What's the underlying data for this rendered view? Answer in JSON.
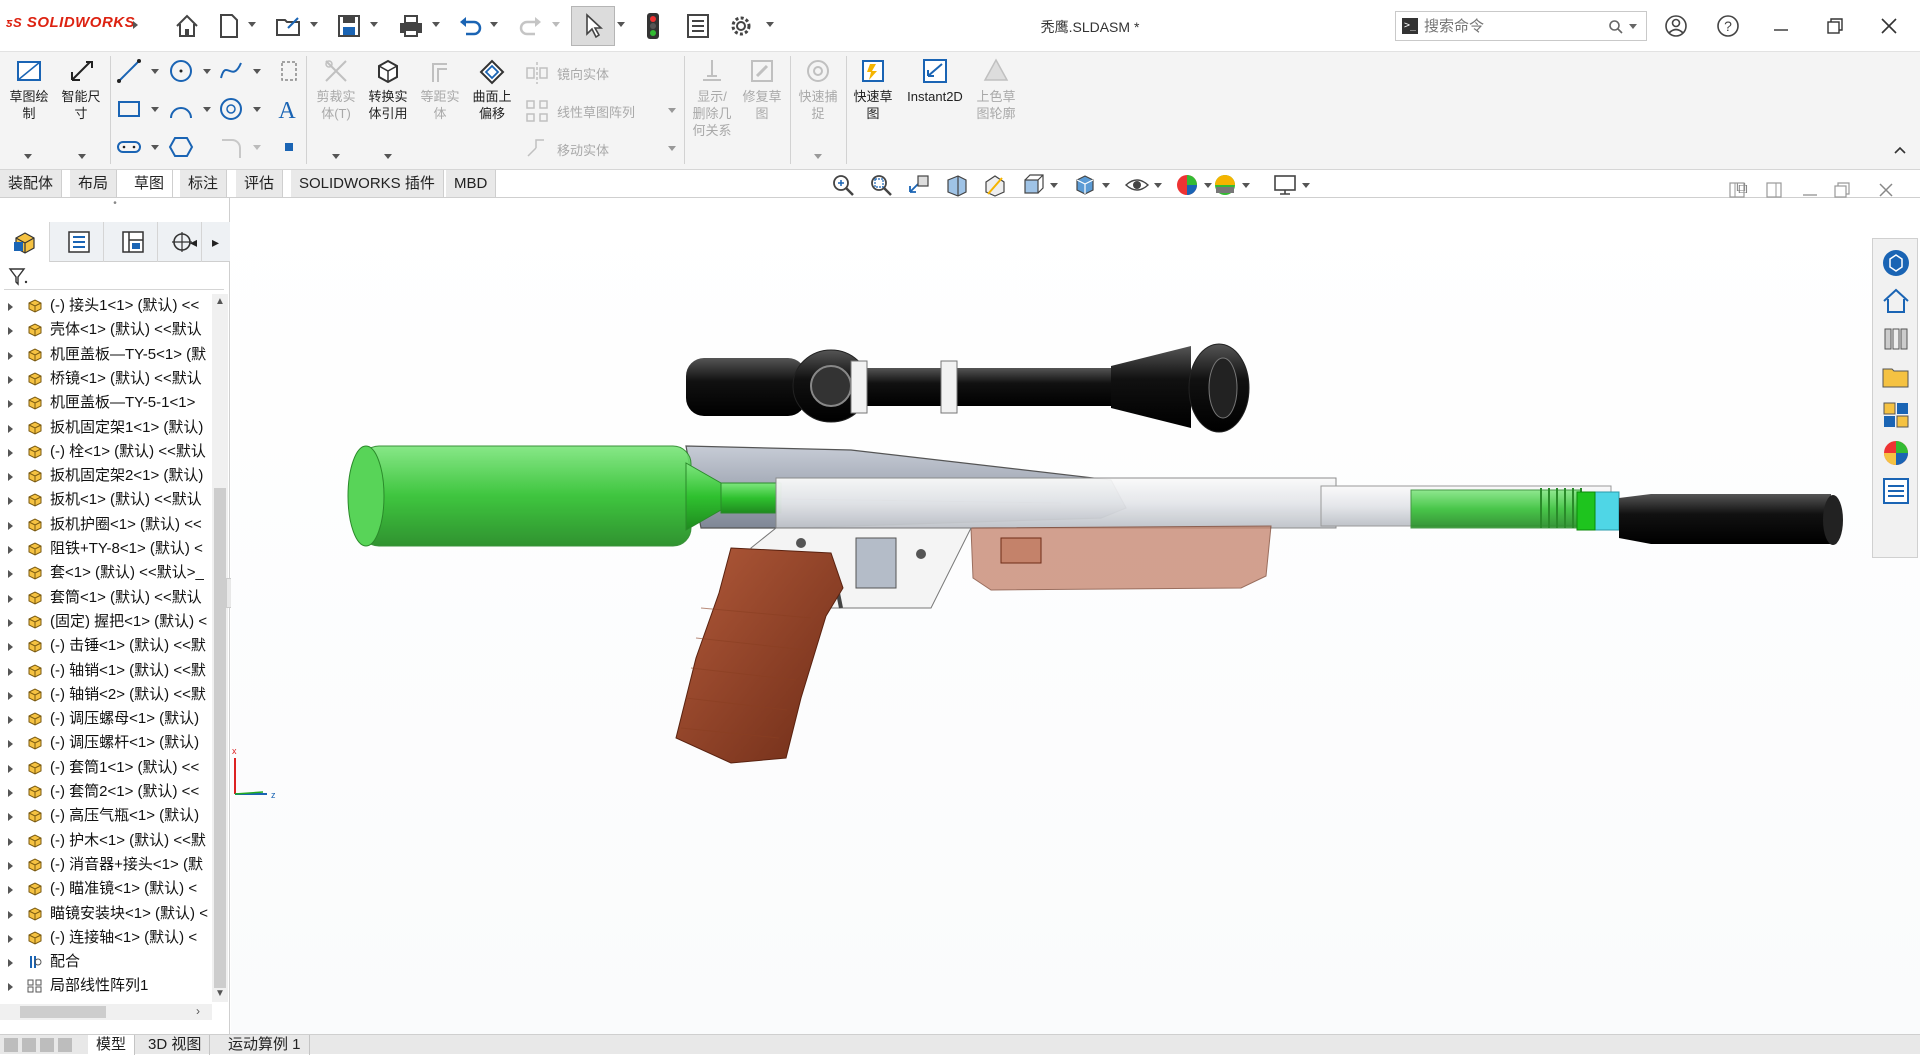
{
  "app": {
    "brand": "SOLIDWORKS",
    "document_title": "秃鹰.SLDASM *"
  },
  "search": {
    "placeholder": "搜索命令"
  },
  "ribbon": {
    "sketch_label": "草图绘\n制",
    "smart_dim_label": "智能尺\n寸",
    "trim_label": "剪裁实\n体(T)",
    "convert_label": "转换实\n体引用",
    "offset_label": "等距实\n体",
    "surface_offset_label": "曲面上\n偏移",
    "mirror_label": "镜向实体",
    "linear_pattern_label": "线性草图阵列",
    "move_label": "移动实体",
    "display_rel_label": "显示/\n删除几\n何关系",
    "repair_label": "修复草\n图",
    "quick_snap_label": "快速捕\n捉",
    "rapid_sketch_label": "快速草\n图",
    "instant2d_label": "Instant2D",
    "shaded_sketch_label": "上色草\n图轮廓"
  },
  "command_tabs": [
    "装配体",
    "布局",
    "草图",
    "标注",
    "评估",
    "SOLIDWORKS 插件",
    "MBD"
  ],
  "active_command_tab": "草图",
  "tree": {
    "items": [
      "(-) 接头1<1> (默认) <<",
      "壳体<1> (默认) <<默认",
      "机匣盖板—TY-5<1> (默",
      "桥镜<1> (默认) <<默认",
      "机匣盖板—TY-5-1<1>",
      "扳机固定架1<1> (默认)",
      "(-) 栓<1> (默认) <<默认",
      "扳机固定架2<1> (默认)",
      "扳机<1> (默认) <<默认",
      "扳机护圈<1> (默认) <<",
      "阻铁+TY-8<1> (默认) <",
      "套<1> (默认) <<默认>_",
      "套筒<1> (默认) <<默认",
      "(固定) 握把<1> (默认) <",
      "(-) 击锤<1> (默认) <<默",
      "(-) 轴销<1> (默认) <<默",
      "(-) 轴销<2> (默认) <<默",
      "(-) 调压螺母<1> (默认)",
      "(-) 调压螺杆<1> (默认)",
      "(-) 套筒1<1> (默认) <<",
      "(-) 套筒2<1> (默认) <<",
      "(-) 高压气瓶<1> (默认)",
      "(-) 护木<1> (默认) <<默",
      "(-) 消音器+接头<1> (默",
      "(-) 瞄准镜<1> (默认) <",
      "瞄镜安装块<1> (默认) <",
      "(-) 连接轴<1> (默认) <"
    ],
    "mates_label": "配合",
    "pattern_label": "局部线性阵列1"
  },
  "triad": {
    "x_label": "x",
    "z_label": "z"
  },
  "bottom_tabs": [
    "模型",
    "3D 视图",
    "运动算例 1"
  ],
  "colors": {
    "brand_red": "#d21a1a",
    "accent_blue": "#1a64b4",
    "selected_tab": "#ffffff"
  }
}
